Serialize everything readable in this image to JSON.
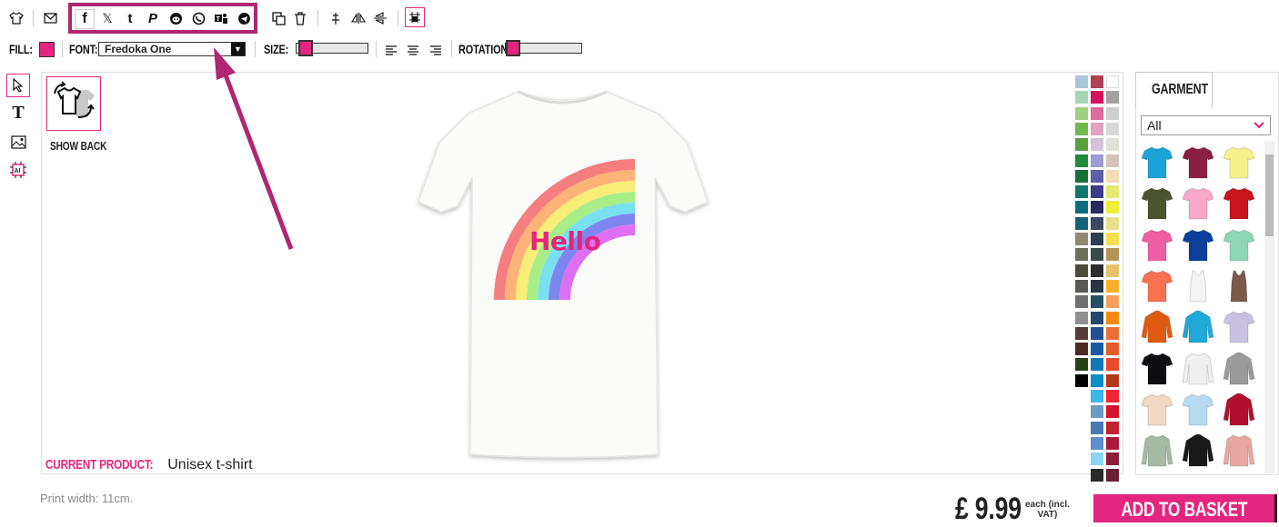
{
  "toolbar": {
    "tools": [
      "tshirt-icon",
      "envelope-icon"
    ],
    "social": [
      "facebook-icon",
      "x-icon",
      "tumblr-icon",
      "pinterest-icon",
      "reddit-icon",
      "whatsapp-icon",
      "teams-icon",
      "telegram-icon"
    ],
    "edit": [
      "duplicate-icon",
      "delete-icon",
      "align-center-icon",
      "flip-horizontal-icon",
      "flip-vertical-icon",
      "snap-grid-icon"
    ]
  },
  "props": {
    "fill_label": "FILL:",
    "font_label": "FONT:",
    "font_value": "Fredoka One",
    "size_label": "SIZE:",
    "rotation_label": "ROTATION:",
    "fill_color": "#e3257f",
    "size_level": 0,
    "rotation_level": 0
  },
  "canvas": {
    "show_back_label": "SHOW BACK",
    "design_text": "Hello",
    "current_product_label": "CURRENT PRODUCT:",
    "current_product_value": " Unisex t-shirt"
  },
  "palette": {
    "columns": [
      [
        "#a9c6d9",
        "#a6d5b8",
        "#9fcf7f",
        "#73b74e",
        "#5a9e3e",
        "#1f8a3a",
        "#16703a",
        "#11786b",
        "#0d6d7a",
        "#166276",
        "#8e8a72",
        "#6b6e57",
        "#4b4a3c",
        "#595855",
        "#6f6f6f",
        "#8f8f8f",
        "#553c3b",
        "#4a2b23",
        "#244216",
        "#000000"
      ],
      [
        "#b04256",
        "#d6125d",
        "#e06b9f",
        "#e3a2c1",
        "#d7c2dc",
        "#9d9bcf",
        "#5e5ea8",
        "#3f3b8b",
        "#2b2b5e",
        "#3f4664",
        "#2c3f4c",
        "#3b4a4a",
        "#2c2d30",
        "#263743",
        "#264f64",
        "#24486b",
        "#234f8c",
        "#1a5b9f",
        "#1178b6",
        "#0c8ec6",
        "#3bb6e6",
        "#6e9bc5",
        "#4a7ab1",
        "#5f8fcb",
        "#8ed5f0",
        "#2b2b2b"
      ],
      [
        "#ffffff",
        "#a2a2a2",
        "#cfcfcf",
        "#d8d8d8",
        "#e3e0da",
        "#d3c5b5",
        "#f1dcb6",
        "#e4ea72",
        "#f0ee3b",
        "#e7e08a",
        "#f5df4f",
        "#b39456",
        "#e5c36d",
        "#f8b02a",
        "#f5a05a",
        "#f38a0f",
        "#eb7035",
        "#e55c2c",
        "#e84a2b",
        "#b13919",
        "#ed2533",
        "#d6112d",
        "#c1202f",
        "#ab1b39",
        "#8a1e34",
        "#6a2136"
      ]
    ]
  },
  "garments": {
    "tab_label": "GARMENT",
    "filter_value": "All",
    "items": [
      {
        "name": "tshirt-cyan",
        "color": "#1aa3d7"
      },
      {
        "name": "tshirt-maroon",
        "color": "#8a1f43"
      },
      {
        "name": "tshirt-yellow",
        "color": "#f5f08a"
      },
      {
        "name": "tshirt-olive",
        "color": "#4c5330"
      },
      {
        "name": "tshirt-pink",
        "color": "#f7a8c8"
      },
      {
        "name": "tshirt-red",
        "color": "#c8141c"
      },
      {
        "name": "tshirt-hot-pink",
        "color": "#ef5ea2"
      },
      {
        "name": "tshirt-royal",
        "color": "#0b3f9a"
      },
      {
        "name": "tshirt-mint",
        "color": "#8fd6b4"
      },
      {
        "name": "tshirt-coral",
        "color": "#f97150"
      },
      {
        "name": "vest-white",
        "color": "#f4f4f4"
      },
      {
        "name": "vest-brown",
        "color": "#7a5a49"
      },
      {
        "name": "hoodie-orange",
        "color": "#e05a12"
      },
      {
        "name": "hoodie-cyan",
        "color": "#20a8d8"
      },
      {
        "name": "tshirt-tiedye",
        "color": "#c9c1e2"
      },
      {
        "name": "tshirt-black",
        "color": "#0e0e12"
      },
      {
        "name": "raglan-white-black",
        "color": "#efefef"
      },
      {
        "name": "hoodie-grey",
        "color": "#9a9a9a"
      },
      {
        "name": "tshirt-beige",
        "color": "#f1d8c2"
      },
      {
        "name": "tshirt-light-blue",
        "color": "#b6dbf0"
      },
      {
        "name": "varsity-red",
        "color": "#b10f2e"
      },
      {
        "name": "longsleeve-sage",
        "color": "#a5b9a4"
      },
      {
        "name": "hoodie-black-orange",
        "color": "#191919"
      },
      {
        "name": "longsleeve-peach",
        "color": "#e8a7a2"
      }
    ]
  },
  "footer": {
    "print_width": "Print width: 11cm.",
    "price": "£ 9.99",
    "price_note_1": "each (incl.",
    "price_note_2": "VAT)",
    "basket_label": "ADD TO BASKET"
  },
  "design": {
    "rainbow": [
      "#f57f7f",
      "#fbb377",
      "#f9ed7a",
      "#a8ee87",
      "#79e0ef",
      "#7d86ef",
      "#dd70f2"
    ]
  }
}
